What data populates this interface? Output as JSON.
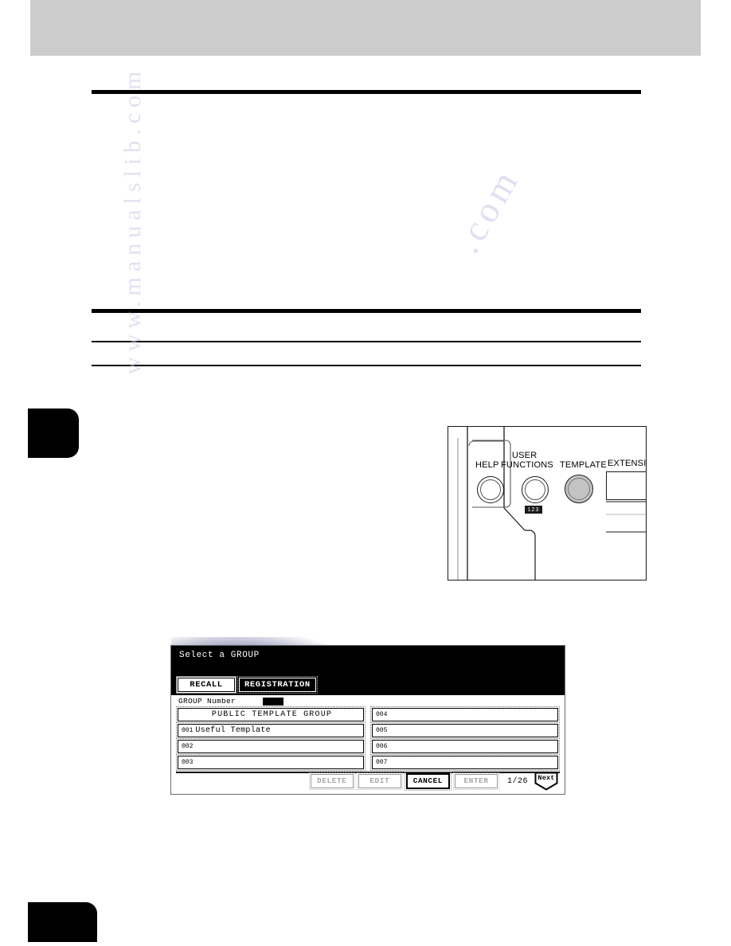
{
  "page": {
    "header_band": "",
    "chapter_tab": "",
    "page_number": ""
  },
  "watermark": {
    "vertical": "www.manualslib.com",
    "diagonal": ".com"
  },
  "illustration": {
    "name": "control-panel-template-key",
    "labels": {
      "help": "HELP",
      "user_functions_line1": "USER",
      "user_functions_line2": "FUNCTIONS",
      "template": "TEMPLATE",
      "extension": "EXTENSION",
      "user_functions_badge": "123"
    }
  },
  "lcd": {
    "title": "Select a GROUP",
    "tabs": [
      {
        "label": "RECALL",
        "selected": false
      },
      {
        "label": "REGISTRATION",
        "selected": true
      }
    ],
    "group_number": {
      "label": "GROUP Number",
      "value": ""
    },
    "groups": [
      {
        "num": "",
        "name": "PUBLIC TEMPLATE GROUP",
        "centered": true
      },
      {
        "num": "004",
        "name": "",
        "centered": false
      },
      {
        "num": "001",
        "name": "Useful Template",
        "centered": false
      },
      {
        "num": "005",
        "name": "",
        "centered": false
      },
      {
        "num": "002",
        "name": "",
        "centered": false
      },
      {
        "num": "006",
        "name": "",
        "centered": false
      },
      {
        "num": "003",
        "name": "",
        "centered": false
      },
      {
        "num": "007",
        "name": "",
        "centered": false
      }
    ],
    "buttons": {
      "delete": "DELETE",
      "edit": "EDIT",
      "cancel": "CANCEL",
      "enter": "ENTER",
      "next": "Next"
    },
    "page_indicator": "1/26"
  }
}
